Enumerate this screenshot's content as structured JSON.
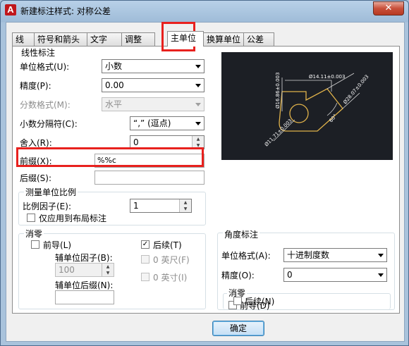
{
  "window": {
    "title": "新建标注样式: 对称公差",
    "close": "✕"
  },
  "tabs": [
    {
      "label": "线"
    },
    {
      "label": "符号和箭头"
    },
    {
      "label": "文字"
    },
    {
      "label": "调整"
    },
    {
      "label": "主单位"
    },
    {
      "label": "换算单位"
    },
    {
      "label": "公差"
    }
  ],
  "linear": {
    "group_label": "线性标注",
    "unit_format": {
      "label": "单位格式(U):",
      "value": "小数"
    },
    "precision": {
      "label": "精度(P):",
      "value": "0.00"
    },
    "fraction_format": {
      "label": "分数格式(M):",
      "value": "水平"
    },
    "decimal_separator": {
      "label": "小数分隔符(C):",
      "value": "“,” (逗点)"
    },
    "round_off": {
      "label": "舍入(R):",
      "value": "0"
    },
    "prefix": {
      "label": "前缀(X):",
      "value": "%%c"
    },
    "suffix": {
      "label": "后缀(S):",
      "value": ""
    }
  },
  "scale": {
    "group_label": "测量单位比例",
    "factor": {
      "label": "比例因子(E):",
      "value": "1"
    },
    "layout_only": {
      "label": "仅应用到布局标注",
      "checked": false
    }
  },
  "zero_suppression": {
    "group_label": "消零",
    "leading": {
      "label": "前导(L)",
      "checked": false
    },
    "trailing": {
      "label": "后续(T)",
      "checked": true
    },
    "sub_unit_factor": {
      "label": "辅单位因子(B):",
      "value": "100"
    },
    "feet": {
      "label": "0 英尺(F)",
      "checked": false
    },
    "inches": {
      "label": "0 英寸(I)",
      "checked": false
    },
    "sub_unit_suffix": {
      "label": "辅单位后缀(N):",
      "value": ""
    }
  },
  "angular": {
    "group_label": "角度标注",
    "unit_format": {
      "label": "单位格式(A):",
      "value": "十进制度数"
    },
    "precision": {
      "label": "精度(O):",
      "value": "0"
    },
    "zero_suppression": {
      "group_label": "消零",
      "leading": {
        "label": "前导(D)",
        "checked": false
      },
      "trailing": {
        "label": "后续(N)",
        "checked": false
      }
    }
  },
  "preview": {
    "dim_top": "Ø14.11±0.003",
    "dim_left": "Ø16.86±0.003",
    "dim_right": "Ø28.07±0.003",
    "dim_angle": "60°",
    "dim_radius": "Ø11.71±0.003"
  },
  "ok_button": "确定",
  "colors": {
    "highlight": "#e8211e",
    "preview_bg": "#1c1f25",
    "dim_text": "#ffffff",
    "part_line": "#e0b24a"
  }
}
